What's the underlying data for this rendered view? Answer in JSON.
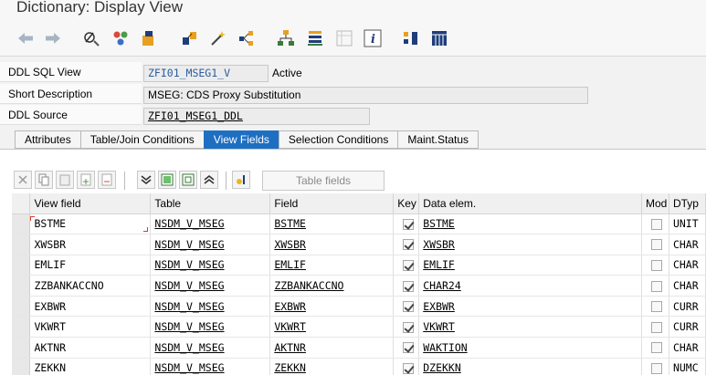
{
  "window": {
    "title": "Dictionary: Display View"
  },
  "toolbar": {
    "icons": [
      "back-icon",
      "forward-icon",
      "toggle-display-change-icon",
      "other-object-icon",
      "activate-icon",
      "check-icon",
      "where-used-icon",
      "navigation-icon",
      "hierarchy-icon",
      "object-list-icon",
      "display-object-list-icon",
      "info-icon",
      "technical-settings-icon",
      "table-contents-icon"
    ]
  },
  "form": {
    "ddl_sql_view_label": "DDL SQL View",
    "ddl_sql_view_value": "ZFI01_MSEG1_V",
    "status": "Active",
    "short_desc_label": "Short Description",
    "short_desc_value": "MSEG: CDS Proxy Substitution",
    "ddl_source_label": "DDL Source",
    "ddl_source_value": "ZFI01_MSEG1_DDL"
  },
  "tabs": [
    {
      "label": "Attributes",
      "active": false
    },
    {
      "label": "Table/Join Conditions",
      "active": false
    },
    {
      "label": "View Fields",
      "active": true
    },
    {
      "label": "Selection Conditions",
      "active": false
    },
    {
      "label": "Maint.Status",
      "active": false
    }
  ],
  "grid_toolbar": {
    "table_fields_label": "Table fields"
  },
  "grid": {
    "columns": {
      "view_field": "View field",
      "table": "Table",
      "field": "Field",
      "key": "Key",
      "data_elem": "Data elem.",
      "mod": "Mod",
      "dtyp": "DTyp"
    },
    "rows": [
      {
        "view_field": "BSTME",
        "table": "NSDM_V_MSEG",
        "field": "BSTME",
        "key": true,
        "data_elem": "BSTME",
        "mod": false,
        "dtyp": "UNIT"
      },
      {
        "view_field": "XWSBR",
        "table": "NSDM_V_MSEG",
        "field": "XWSBR",
        "key": true,
        "data_elem": "XWSBR",
        "mod": false,
        "dtyp": "CHAR"
      },
      {
        "view_field": "EMLIF",
        "table": "NSDM_V_MSEG",
        "field": "EMLIF",
        "key": true,
        "data_elem": "EMLIF",
        "mod": false,
        "dtyp": "CHAR"
      },
      {
        "view_field": "ZZBANKACCNO",
        "table": "NSDM_V_MSEG",
        "field": "ZZBANKACCNO",
        "key": true,
        "data_elem": "CHAR24",
        "mod": false,
        "dtyp": "CHAR"
      },
      {
        "view_field": "EXBWR",
        "table": "NSDM_V_MSEG",
        "field": "EXBWR",
        "key": true,
        "data_elem": "EXBWR",
        "mod": false,
        "dtyp": "CURR"
      },
      {
        "view_field": "VKWRT",
        "table": "NSDM_V_MSEG",
        "field": "VKWRT",
        "key": true,
        "data_elem": "VKWRT",
        "mod": false,
        "dtyp": "CURR"
      },
      {
        "view_field": "AKTNR",
        "table": "NSDM_V_MSEG",
        "field": "AKTNR",
        "key": true,
        "data_elem": "WAKTION",
        "mod": false,
        "dtyp": "CHAR"
      },
      {
        "view_field": "ZEKKN",
        "table": "NSDM_V_MSEG",
        "field": "ZEKKN",
        "key": true,
        "data_elem": "DZEKKN",
        "mod": false,
        "dtyp": "NUMC"
      }
    ]
  }
}
